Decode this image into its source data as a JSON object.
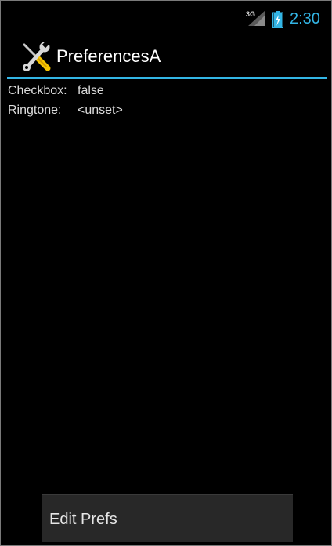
{
  "status_bar": {
    "network_type": "3G",
    "time": "2:30",
    "icons": [
      "signal-icon",
      "battery-charging-icon"
    ],
    "accent_color": "#33b5e5"
  },
  "action_bar": {
    "title": "PreferencesA",
    "icon": "tools-icon",
    "divider_color": "#33b5e5"
  },
  "preferences": [
    {
      "label": "Checkbox:",
      "value": "false"
    },
    {
      "label": "Ringtone:",
      "value": "<unset>"
    }
  ],
  "menu": {
    "items": [
      {
        "label": "Edit Prefs"
      }
    ]
  }
}
